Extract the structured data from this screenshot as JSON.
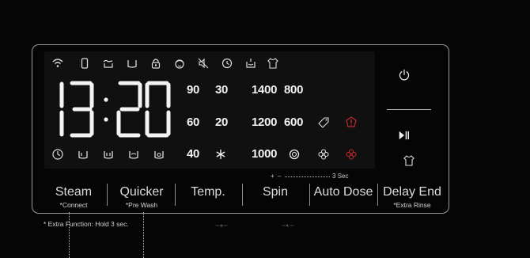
{
  "display": {
    "time": "13:20",
    "temps_row1": [
      "90",
      "30"
    ],
    "temps_row2": [
      "60",
      "20"
    ],
    "temps_row3": [
      "40"
    ],
    "spins_row1": [
      "1400",
      "800"
    ],
    "spins_row2": [
      "1200",
      "600"
    ],
    "spins_row3": [
      "1000"
    ],
    "top_icons": [
      "wifi-icon",
      "phone-icon",
      "hand-wash-icon",
      "tub-icon",
      "door-lock-icon",
      "child-lock-icon",
      "mute-icon",
      "time-icon",
      "detergent-icon",
      "shirt-icon"
    ],
    "bottom_icons": [
      "clock-icon",
      "tub-icon",
      "tub-double-icon",
      "tub-wave-icon",
      "drum-icon"
    ],
    "accent_red": "#c0282d"
  },
  "buttons": {
    "steam_label": "Steam",
    "steam_sub": "*Connect",
    "quicker_label": "Quicker",
    "quicker_sub": "*Pre Wash",
    "temp_label": "Temp.",
    "spin_label": "Spin",
    "autodose_label": "Auto Dose",
    "delayend_label": "Delay End",
    "delayend_sub": "*Extra Rinse"
  },
  "hint": {
    "plus": "+",
    "minus": "–",
    "hold": "3 Sec"
  },
  "footnote": "* Extra Function: Hold 3 sec."
}
